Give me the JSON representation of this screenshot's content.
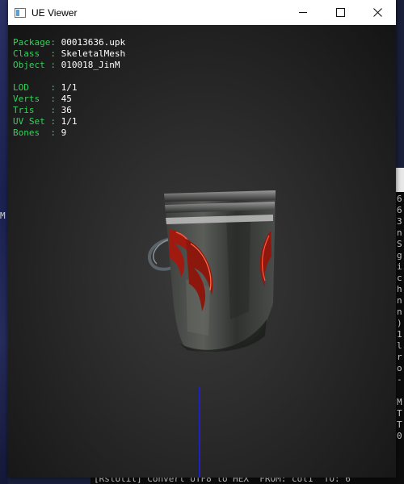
{
  "window": {
    "title": "UE Viewer",
    "controls": {
      "minimize_icon": "minimize-icon",
      "maximize_icon": "maximize-icon",
      "close_icon": "close-icon"
    }
  },
  "info": {
    "package_label": "Package:",
    "package_value": "00013636.upk",
    "class_label": "Class  :",
    "class_value": "SkeletalMesh",
    "object_label": "Object :",
    "object_value": "010018_JinM",
    "lod_label": "LOD    :",
    "lod_value": "1/1",
    "verts_label": "Verts  :",
    "verts_value": "45",
    "tris_label": "Tris   :",
    "tris_value": "36",
    "uvset_label": "UV Set :",
    "uvset_value": "1/1",
    "bones_label": "Bones  :",
    "bones_value": "9"
  },
  "background": {
    "left_glyph": "M",
    "terminal_lines": "6\n6\n3\nn\nS\ng\ni\nc\nh\nn\nn\n)\n1\nl\nr\no\n-\n\nM\nT\nT\n0",
    "terminal_bottom": "[RstUtil] Convert UTF8 to HEX  FROM: col1  TO: 6"
  },
  "colors": {
    "label_green": "#33d05a",
    "value_white": "#ffffff",
    "axis_blue": "#2020c8"
  }
}
